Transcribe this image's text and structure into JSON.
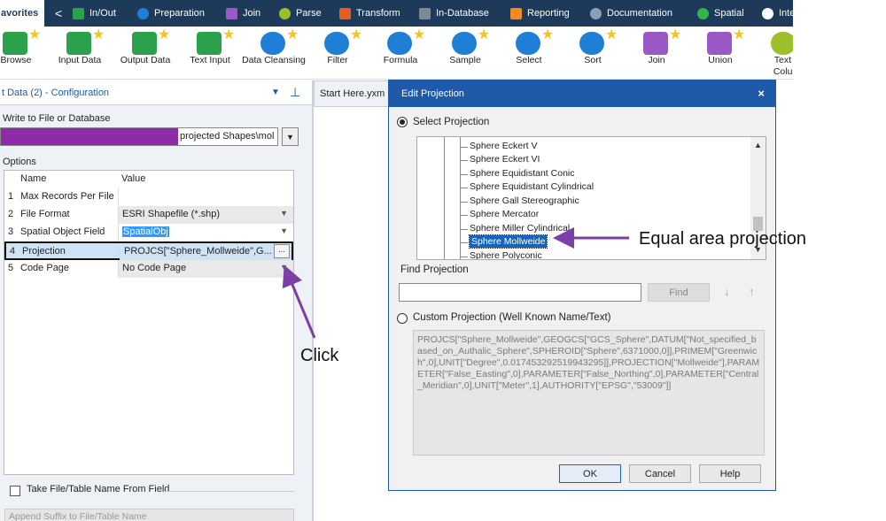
{
  "category_tabs": {
    "favorites": "avorites",
    "back": "<",
    "items": [
      "In/Out",
      "Preparation",
      "Join",
      "Parse",
      "Transform",
      "In-Database",
      "Reporting",
      "Documentation",
      "Spatial",
      "Inte"
    ]
  },
  "tools": [
    "Browse",
    "Input Data",
    "Output Data",
    "Text Input",
    "Data Cleansing",
    "Filter",
    "Formula",
    "Sample",
    "Select",
    "Sort",
    "Join",
    "Union",
    "Text T Colum"
  ],
  "config": {
    "title": "t Data (2) - Configuration",
    "write_label": "Write to File or Database",
    "file_path": "projected Shapes\\mol",
    "options_label": "Options",
    "grid_header": {
      "name": "Name",
      "value": "Value"
    },
    "rows": [
      {
        "num": "1",
        "name": "Max Records Per File",
        "value": ""
      },
      {
        "num": "2",
        "name": "File Format",
        "value": "ESRI Shapefile (*.shp)"
      },
      {
        "num": "3",
        "name": "Spatial Object Field",
        "value": "SpatialObj"
      },
      {
        "num": "4",
        "name": "Projection",
        "value": "PROJCS[\"Sphere_Mollweide\",G..."
      },
      {
        "num": "5",
        "name": "Code Page",
        "value": "No Code Page"
      }
    ],
    "ellipsis": "...",
    "take_label": "Take File/Table Name From Field",
    "append_placeholder": "Append Suffix to File/Table Name"
  },
  "canvas_tab": "Start Here.yxm",
  "dialog": {
    "title": "Edit Projection",
    "close": "×",
    "select_label": "Select Projection",
    "tree_items": [
      "Sphere Eckert V",
      "Sphere Eckert VI",
      "Sphere Equidistant Conic",
      "Sphere Equidistant Cylindrical",
      "Sphere Gall Stereographic",
      "Sphere Mercator",
      "Sphere Miller Cylindrical",
      "Sphere Mollweide",
      "Sphere Polyconic"
    ],
    "find_label": "Find Projection",
    "find_button": "Find",
    "custom_label": "Custom Projection (Well Known Name/Text)",
    "wkt": "PROJCS[\"Sphere_Mollweide\",GEOGCS[\"GCS_Sphere\",DATUM[\"Not_specified_based_on_Authalic_Sphere\",SPHEROID[\"Sphere\",6371000,0]],PRIMEM[\"Greenwich\",0],UNIT[\"Degree\",0.017453292519943295]],PROJECTION[\"Mollweide\"],PARAMETER[\"False_Easting\",0],PARAMETER[\"False_Northing\",0],PARAMETER[\"Central_Meridian\",0],UNIT[\"Meter\",1],AUTHORITY[\"EPSG\",\"53009\"]]",
    "ok": "OK",
    "cancel": "Cancel",
    "help": "Help"
  },
  "annotations": {
    "equal_area": "Equal area projection",
    "click": "Click",
    "arrow_color": "#7b3fa6"
  },
  "colors": {
    "accent": "#1f5aa8",
    "redaction": "#8e2ba8"
  }
}
